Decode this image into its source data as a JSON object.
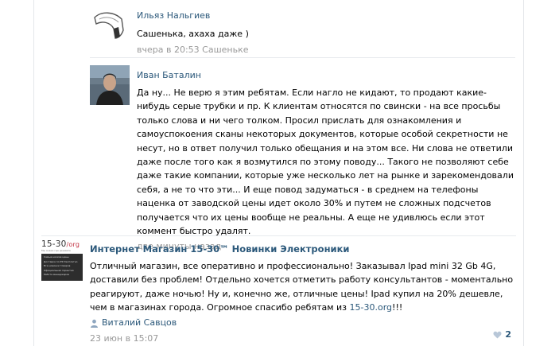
{
  "replies": [
    {
      "author": "Ильяз Нальгиев",
      "text": "Сашенька, ахаха даже )",
      "time": "вчера в 20:53",
      "reply_to": "Сашеньке"
    },
    {
      "author": "Иван Баталин",
      "text": "Да ну... Не верю я этим ребятам. Если нагло не кидают, то продают какие-нибудь серые трубки и пр. К клиентам относятся по свински - на все просьбы только слова и ни чего толком. Просил прислать для ознакомления и самоуспокоения сканы некоторых документов, которые особой секретности не несут, но в ответ получил только обещания и на этом все. Ни слова не ответили даже после того как я возмутился по этому поводу... Такого не позволяют себе даже такие компании, которые уже несколько лет на рынке и зарекомендовали себя, а не то что эти... И еще повод задуматься - в среднем на телефоны наценка от заводской цены идет около 30% и путем не сложных подсчетов получается что их цены вообще не реальны. А еще не удивлюсь если этот коммент быстро удалят.",
      "time": "две минуты назад"
    }
  ],
  "post": {
    "logo_text": "15-30",
    "logo_suffix": "/org",
    "logo_tagline": "Мы знаем где дешевле",
    "logo_lines": [
      "Самые низкие цены",
      "Доставка по РФ бесплатно",
      "Все новинки товаров",
      "Официальная гарантия",
      "Работа менеджеров"
    ],
    "author": "Интернет Магазин 15-30™ Новинки Электроники",
    "text_before_link": "Отличный магазин, все оперативно и профессионально! Заказывал Ipad mini 32 Gb 4G, доставили без проблем! Отдельно хочется отметить работу консультантов - моментально реагируют, даже ночью! Ну и, конечно же, отличные цены! Ipad купил на 20% дешевле, чем в магазинах города. Огромное спасибо ребятам из ",
    "link": "15-30.org",
    "text_after_link": "!!!",
    "signer": "Виталий Савцов",
    "time": "23 июн в 15:07",
    "likes": "2"
  },
  "colors": {
    "link": "#2b587a",
    "muted": "#999999",
    "divider": "#e7eaed"
  }
}
